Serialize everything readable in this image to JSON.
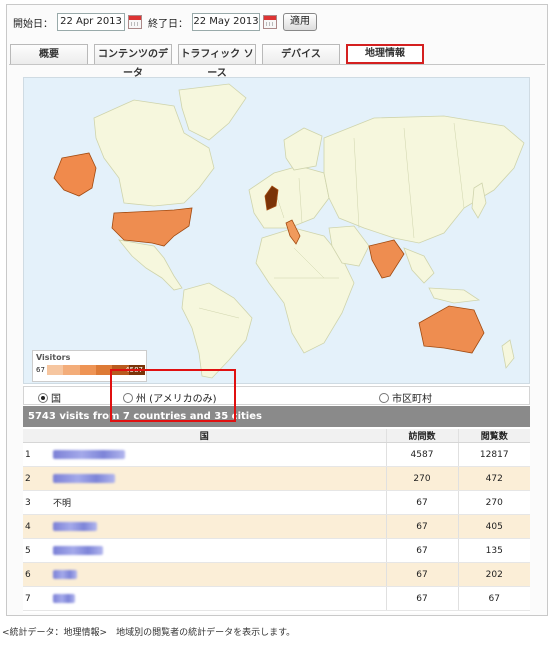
{
  "datebar": {
    "start_label": "開始日：",
    "start_value": "22 Apr 2013",
    "end_label": "終了日：",
    "end_value": "22 May 2013",
    "apply_label": "適用"
  },
  "tabs": [
    "概要",
    "コンテンツのデータ",
    "トラフィック ソース",
    "デバイス",
    "地理情報"
  ],
  "active_tab": "地理情報",
  "map": {
    "legend_title": "Visitors",
    "legend_min": "67",
    "legend_max": "4587",
    "colors": {
      "ocean": "#e4f1fa",
      "land": "#f6f7dd",
      "border": "#cfd4ac",
      "low": "#f09a5c",
      "high": "#7a3308"
    }
  },
  "radios": [
    {
      "label": "国",
      "selected": true
    },
    {
      "label": "州 (アメリカのみ)",
      "selected": false
    },
    {
      "label": "市区町村",
      "selected": false
    }
  ],
  "summary": "5743 visits from 7 countries and 35 cities",
  "table": {
    "headers": {
      "country": "国",
      "visits": "訪問数",
      "pageviews": "閲覧数"
    },
    "rows": [
      {
        "num": "1",
        "country": "",
        "visits": "4587",
        "pageviews": "12817"
      },
      {
        "num": "2",
        "country": "",
        "visits": "270",
        "pageviews": "472"
      },
      {
        "num": "3",
        "country": "不明",
        "visits": "67",
        "pageviews": "270"
      },
      {
        "num": "4",
        "country": "",
        "visits": "67",
        "pageviews": "405"
      },
      {
        "num": "5",
        "country": "",
        "visits": "67",
        "pageviews": "135"
      },
      {
        "num": "6",
        "country": "",
        "visits": "67",
        "pageviews": "202"
      },
      {
        "num": "7",
        "country": "",
        "visits": "67",
        "pageviews": "67"
      }
    ]
  },
  "caption": "<統計データ：地理情報>　地域別の閲覧者の統計データを表示します。"
}
